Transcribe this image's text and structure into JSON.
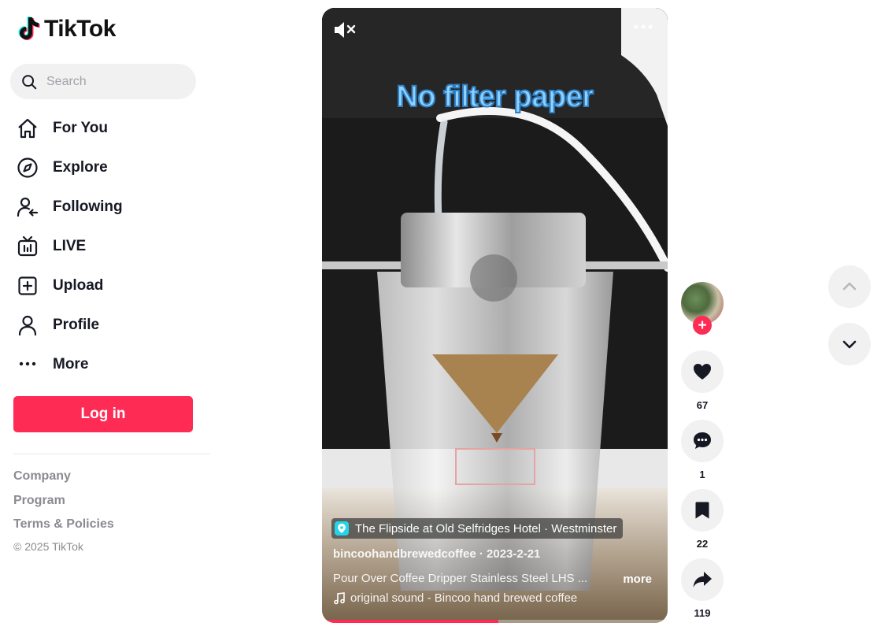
{
  "brand": {
    "name": "TikTok"
  },
  "search": {
    "placeholder": "Search"
  },
  "nav": {
    "items": [
      {
        "label": "For You",
        "icon": "home-icon"
      },
      {
        "label": "Explore",
        "icon": "compass-icon"
      },
      {
        "label": "Following",
        "icon": "following-icon"
      },
      {
        "label": "LIVE",
        "icon": "live-icon"
      },
      {
        "label": "Upload",
        "icon": "upload-icon"
      },
      {
        "label": "Profile",
        "icon": "profile-icon"
      },
      {
        "label": "More",
        "icon": "more-icon"
      }
    ]
  },
  "login": {
    "label": "Log in"
  },
  "footer": {
    "links": [
      "Company",
      "Program",
      "Terms & Policies"
    ],
    "copyright": "© 2025 TikTok"
  },
  "video": {
    "caption": "No filter paper",
    "location": "The Flipside at Old Selfridges Hotel · Westminster",
    "author_line": "bincoohandbrewedcoffee · 2023-2-21",
    "description": "Pour Over Coffee Dripper Stainless Steel LHS ...",
    "more_label": "more",
    "sound": "original sound - Bincoo hand brewed coffee",
    "progress": 0.51
  },
  "actions": {
    "likes": "67",
    "comments": "1",
    "saves": "22",
    "shares": "119"
  },
  "colors": {
    "accent": "#fe2c55",
    "caption_fill": "#8fd2ff",
    "caption_stroke": "#2e7fc4"
  }
}
